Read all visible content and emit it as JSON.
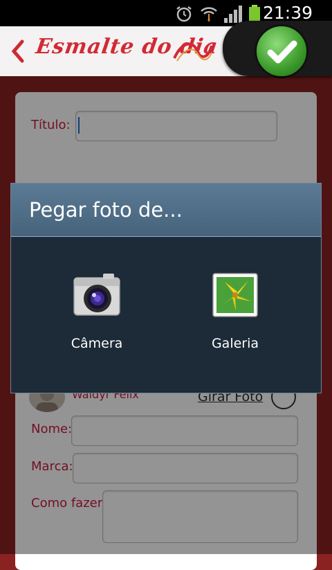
{
  "status": {
    "time": "21:39"
  },
  "header": {
    "title": "Esmalte do dia"
  },
  "form": {
    "title_label": "Título:",
    "author_name": "Waldyr Felix",
    "rotate_label": "Girar Foto",
    "name_label": "Nome:",
    "brand_label": "Marca:",
    "howto_label": "Como fazer:"
  },
  "dialog": {
    "title": "Pegar foto de...",
    "options": [
      {
        "label": "Câmera",
        "icon": "camera-icon"
      },
      {
        "label": "Galeria",
        "icon": "gallery-icon"
      }
    ]
  },
  "colors": {
    "accent": "#c61b3b",
    "confirm": "#3a9a2a",
    "dialog_bg": "#1c2b37",
    "dialog_header": "#4f6f88"
  }
}
